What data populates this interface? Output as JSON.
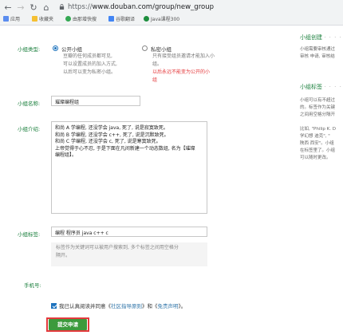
{
  "browser": {
    "url_scheme": "https://",
    "url_rest": "www.douban.com/group/new_group",
    "bookmarks": [
      {
        "label": "应用",
        "color": "#5b8def"
      },
      {
        "label": "收藏夹",
        "color": "#f5c033"
      },
      {
        "label": "由那增快搜",
        "color": "#34a853"
      },
      {
        "label": "谷歌翻译",
        "color": "#4285f4"
      },
      {
        "label": "Java课程300",
        "color": "#1e8e3e"
      }
    ]
  },
  "form": {
    "type_label": "小组类型:",
    "public": {
      "title": "公开小组",
      "desc": [
        "豆瓣的任何成员都可见,",
        "可以设置成员的加入方式,",
        "以后可以变为私密小组。"
      ]
    },
    "private": {
      "title": "私密小组",
      "desc": [
        "只有接受组员邀请才能加入小",
        "组。"
      ],
      "warning": [
        "以后永远不能变为公开的小",
        "组"
      ]
    },
    "name_label": "小组名称:",
    "name_value": "璀璨编程组",
    "intro_label": "小组介绍:",
    "intro_lines": [
      "和尚 A 学编程, 还没学会 java, 死了, 说是寂寞致死。",
      "和尚 B 学编程, 还没学会 c++, 死了, 说是沉默致死。",
      "和尚 C 学编程, 还没学会 c, 死了, 说是寒寞致死。",
      "上帝觉得于心不忍, 于是下面在凡间新建一个动态数组, 名为【璀璨",
      "编程组】。"
    ],
    "tags_label": "小组标签:",
    "tags_value": "编程 程序员 java c++ c",
    "tags_hint": [
      "标签作为关键词可以被用户搜索到, 多个标签之间用空格分",
      "隔开。"
    ],
    "phone_label": "手机号:",
    "agree_prefix": "我已认真阅读并同意《",
    "agree_link1": "社区指导原则",
    "agree_mid": "》和《",
    "agree_link2": "免责声明",
    "agree_suffix": "》。",
    "submit_label": "提交申请"
  },
  "sidebar": {
    "create": {
      "title": "小组创建",
      "dots": "· · · ·",
      "lines": [
        "小组需要审核通过",
        "审核 申请, 审核结"
      ]
    },
    "tags": {
      "title": "小组标签",
      "dots": "· · · ·",
      "lines": [
        "小组可以有不超过",
        "的。标签作为关键",
        "之间用空格分隔开"
      ],
      "lines2": [
        "比如, \"Philip K. D",
        "学幻想 迪克\", \"",
        "陕西 西安\"。小组",
        "在标签里了。小组",
        "可以随时更改。"
      ]
    }
  },
  "colors": {
    "accent_green": "#1a7f3c",
    "submit_green": "#3c9a3c",
    "warning_red": "#e4393c",
    "link_blue": "#3377aa"
  }
}
